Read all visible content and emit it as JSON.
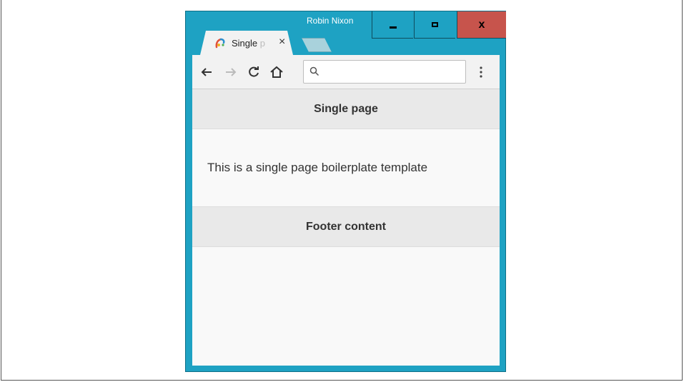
{
  "window": {
    "user": "Robin Nixon",
    "controls": {
      "minimize": "minimize",
      "maximize": "maximize",
      "close": "x"
    }
  },
  "tab": {
    "title_visible": "Single",
    "title_faded": "p",
    "close": "×"
  },
  "toolbar": {
    "back": "←",
    "forward": "→",
    "reload": "C",
    "home": "home",
    "address_value": "",
    "address_placeholder": "",
    "menu": "⋮"
  },
  "page": {
    "header": "Single page",
    "body": "This is a single page boilerplate template",
    "footer": "Footer content"
  },
  "colors": {
    "window_frame": "#1ea2c3",
    "close_button": "#c7544c",
    "bar_bg": "#e9e9e9",
    "page_bg": "#f9f9f9"
  },
  "icons": [
    "favicon-icon",
    "close-icon",
    "back-arrow-icon",
    "forward-arrow-icon",
    "reload-icon",
    "home-icon",
    "search-icon",
    "menu-dots-icon",
    "minimize-icon",
    "maximize-icon"
  ]
}
